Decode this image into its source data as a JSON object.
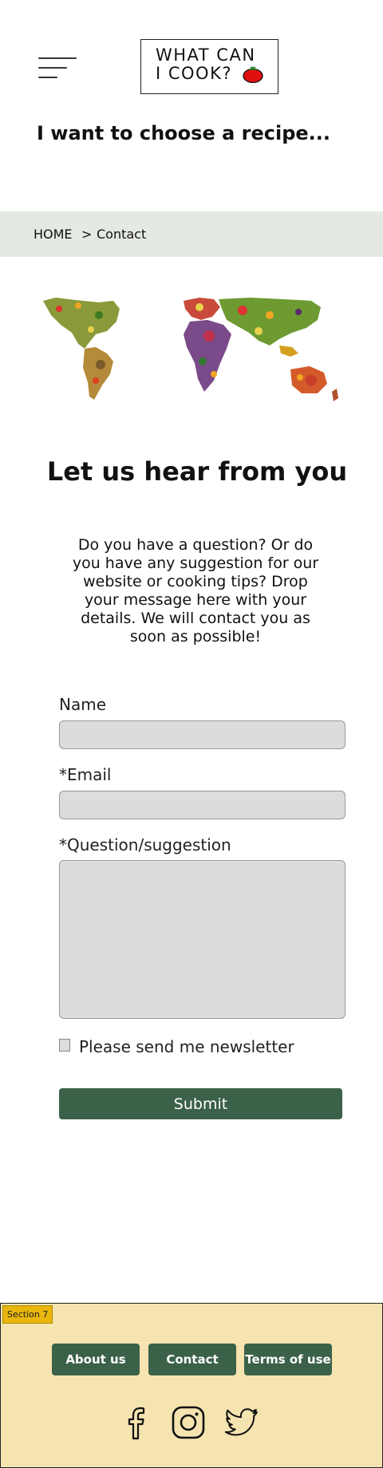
{
  "header": {
    "logo_line1": "WHAT CAN",
    "logo_line2": "I COOK?",
    "tagline": "I want to choose a recipe..."
  },
  "breadcrumb": {
    "home": "HOME",
    "separator": ">",
    "current": "Contact"
  },
  "main": {
    "heading": "Let us hear from you",
    "intro": "Do you have a question? Or do you have any suggestion for our website or cooking tips? Drop your message here with your details. We will contact you as soon as possible!"
  },
  "form": {
    "name_label": "Name",
    "name_value": "",
    "email_label": "*Email",
    "email_value": "",
    "question_label": "*Question/suggestion",
    "question_value": "",
    "newsletter_label": "Please send me newsletter",
    "newsletter_checked": false,
    "submit_label": "Submit"
  },
  "footer": {
    "section_badge": "Section 7",
    "links": [
      "About us",
      "Contact",
      "Terms of use"
    ],
    "social_icons": [
      "facebook-icon",
      "instagram-icon",
      "twitter-icon"
    ]
  },
  "colors": {
    "accent_green": "#3b6149",
    "breadcrumb_bg": "#e5e9e3",
    "footer_bg": "#f5e3b0",
    "badge_bg": "#e8b60d",
    "input_bg": "#dcdcdc"
  },
  "icons": {
    "menu": "hamburger-menu-icon",
    "logo_mark": "tomato-icon",
    "map": "world-map-of-vegetables-image"
  }
}
